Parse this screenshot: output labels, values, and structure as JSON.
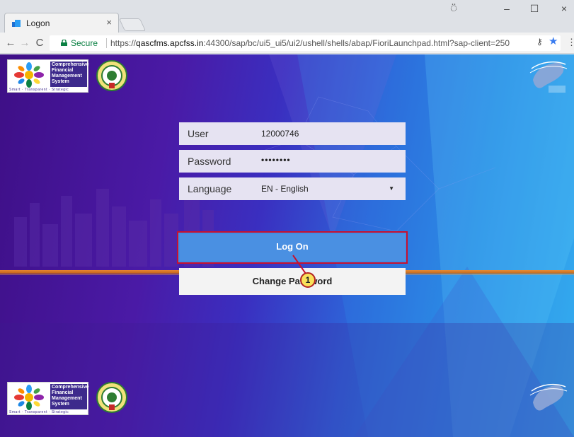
{
  "browser": {
    "tab_title": "Logon",
    "tab_close": "×",
    "window_controls": {
      "profile": "⍥",
      "minimize": "–",
      "maximize": "☐",
      "close": "×"
    },
    "nav": {
      "back": "←",
      "forward": "→",
      "reload": "C"
    },
    "security_label": "Secure",
    "url_prefix": "https://",
    "url_host": "qascfms.apcfss.in",
    "url_rest": ":44300/sap/bc/ui5_ui5/ui2/ushell/shells/abap/FioriLaunchpad.html?sap-client=250",
    "toolbar_icons": {
      "key": "⚷",
      "star": "★",
      "menu": "⋮"
    }
  },
  "header": {
    "cfms_logo_lines": [
      "Comprehensive",
      "Financial",
      "Management",
      "System"
    ],
    "cfms_tagline": "Smart · Transparent · Strategic"
  },
  "form": {
    "user_label": "User",
    "user_value": "12000746",
    "password_label": "Password",
    "password_value": "••••••••",
    "language_label": "Language",
    "language_value": "EN - English",
    "dropdown_arrow": "▼"
  },
  "buttons": {
    "logon_label": "Log On",
    "change_password_label": "Change Password"
  },
  "callout": {
    "number": "1"
  },
  "colors": {
    "accent_blue": "#4a90e2",
    "highlight_red": "#c8102e",
    "callout_yellow": "#f9e25a",
    "band_orange": "#f08a2a"
  }
}
